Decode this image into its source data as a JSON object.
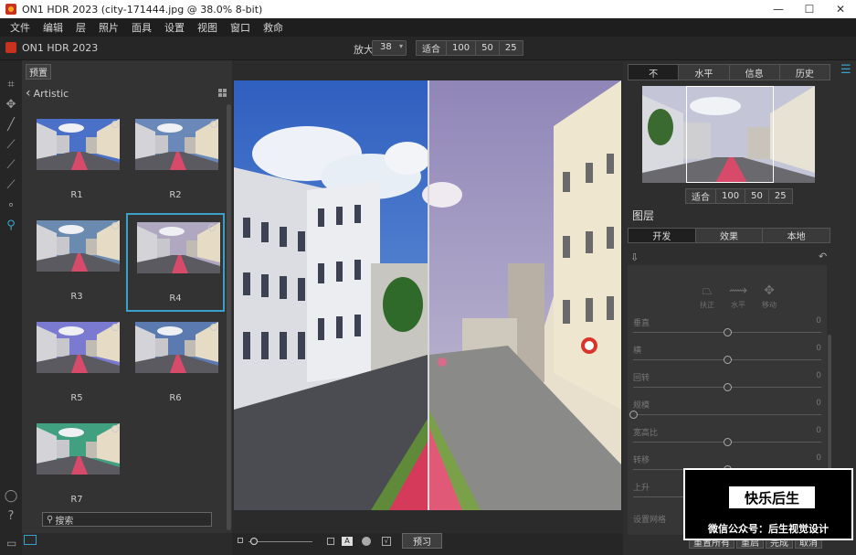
{
  "titlebar": {
    "title": "ON1 HDR 2023 (city-171444.jpg @ 38.0% 8-bit)",
    "minimize": "—",
    "maximize": "☐",
    "close": "✕"
  },
  "menu": [
    "文件",
    "编辑",
    "层",
    "照片",
    "面具",
    "设置",
    "视图",
    "窗口",
    "救命"
  ],
  "toolbar": {
    "app_name": "ON1 HDR 2023",
    "zoom_label": "放大",
    "zoom_value": "38",
    "zoom_buttons": [
      "适合",
      "100",
      "50",
      "25"
    ]
  },
  "presets": {
    "header_button": "预置",
    "category": "Artistic",
    "items": [
      {
        "label": "R1",
        "tint": "#4a70c8"
      },
      {
        "label": "R2",
        "tint": "#6a88b8"
      },
      {
        "label": "R3",
        "tint": "#6a8ab0"
      },
      {
        "label": "R4",
        "tint": "#b0a8c0",
        "selected": true
      },
      {
        "label": "R5",
        "tint": "#7a7ad0"
      },
      {
        "label": "R6",
        "tint": "#5a7ab0"
      },
      {
        "label": "R7",
        "tint": "#40a080"
      }
    ],
    "search_placeholder": "搜索"
  },
  "canvas": {
    "preview_button": "预习"
  },
  "right": {
    "nav_tabs": [
      "不",
      "水平",
      "信息",
      "历史"
    ],
    "nav_zoom_buttons": [
      "适合",
      "100",
      "50",
      "25"
    ],
    "layers_title": "图层",
    "layer_tabs": [
      "开发",
      "效果",
      "本地"
    ],
    "tools": [
      {
        "label": "扶正"
      },
      {
        "label": "水平"
      },
      {
        "label": "移动"
      }
    ],
    "sliders": [
      {
        "label": "垂直",
        "value": "0",
        "pos": 0.5
      },
      {
        "label": "横",
        "value": "0",
        "pos": 0.5
      },
      {
        "label": "回转",
        "value": "0",
        "pos": 0.5
      },
      {
        "label": "规模",
        "value": "0",
        "pos": 0.0
      },
      {
        "label": "宽高比",
        "value": "0",
        "pos": 0.5
      },
      {
        "label": "转移",
        "value": "0",
        "pos": 0.5
      },
      {
        "label": "上升",
        "value": "0",
        "pos": 0.5
      }
    ],
    "last_label": "设置网格",
    "bottom_buttons": [
      "重置所有",
      "重启",
      "完成",
      "取消"
    ]
  },
  "watermark": {
    "title": "快乐后生",
    "subtitle": "微信公众号：后生视觉设计"
  }
}
